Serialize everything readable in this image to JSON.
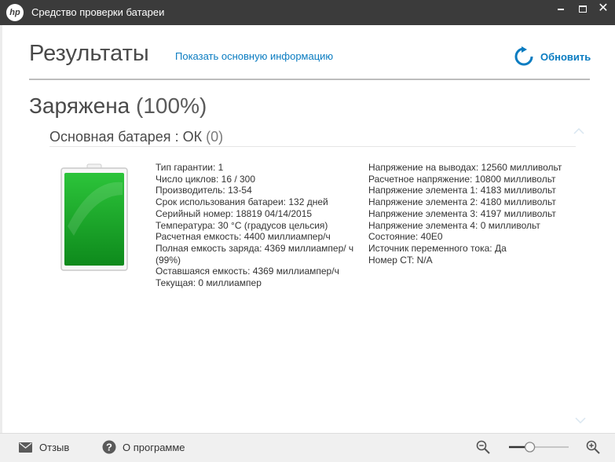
{
  "window": {
    "title": "Средство проверки батареи",
    "logo_text": "hp",
    "close_glyph": "✕"
  },
  "header": {
    "title": "Результаты",
    "info_link": "Показать основную информацию",
    "refresh_label": "Обновить"
  },
  "status": {
    "state": "Заряжена",
    "percent": "(100%)"
  },
  "battery": {
    "name": "Основная батарея",
    "separator": ":",
    "result": "ОК",
    "code": "(0)",
    "charge_level": 1.0,
    "fill_color": "#1aa32a"
  },
  "details_left": [
    "Тип гарантии: 1",
    "Число циклов: 16 / 300",
    "Производитель: 13-54",
    "Срок использования батареи: 132 дней",
    "Серийный номер: 18819 04/14/2015",
    "Температура: 30 °C (градусов цельсия)",
    "Расчетная емкость: 4400 миллиампер/ч",
    "Полная емкость заряда: 4369 миллиампер/ ч (99%)",
    "Оставшаяся емкость: 4369 миллиампер/ч",
    "Текущая: 0 миллиампер"
  ],
  "details_right": [
    "Напряжение на выводах: 12560 милливольт",
    "Расчетное напряжение: 10800 милливольт",
    "Напряжение элемента 1: 4183 милливольт",
    "Напряжение элемента 2: 4180 милливольт",
    "Напряжение элемента 3: 4197 милливольт",
    "Напряжение элемента 4: 0 милливольт",
    "Состояние: 40E0",
    "Источник переменного тока: Да",
    "Номер CT: N/A"
  ],
  "footer": {
    "feedback_label": "Отзыв",
    "about_label": "О программе",
    "zoom_level": 0.35
  },
  "colors": {
    "titlebar": "#3b3b3b",
    "accent": "#0a7cc1",
    "battery_green": "#1aa32a"
  },
  "icons": {
    "logo": "hp-logo-icon",
    "refresh": "refresh-icon",
    "feedback": "envelope-icon",
    "about": "help-circle-icon",
    "zoom_out": "zoom-out-icon",
    "zoom_in": "zoom-in-icon",
    "collapse": "chevron-up-icon",
    "scroll": "chevron-down-icon"
  }
}
